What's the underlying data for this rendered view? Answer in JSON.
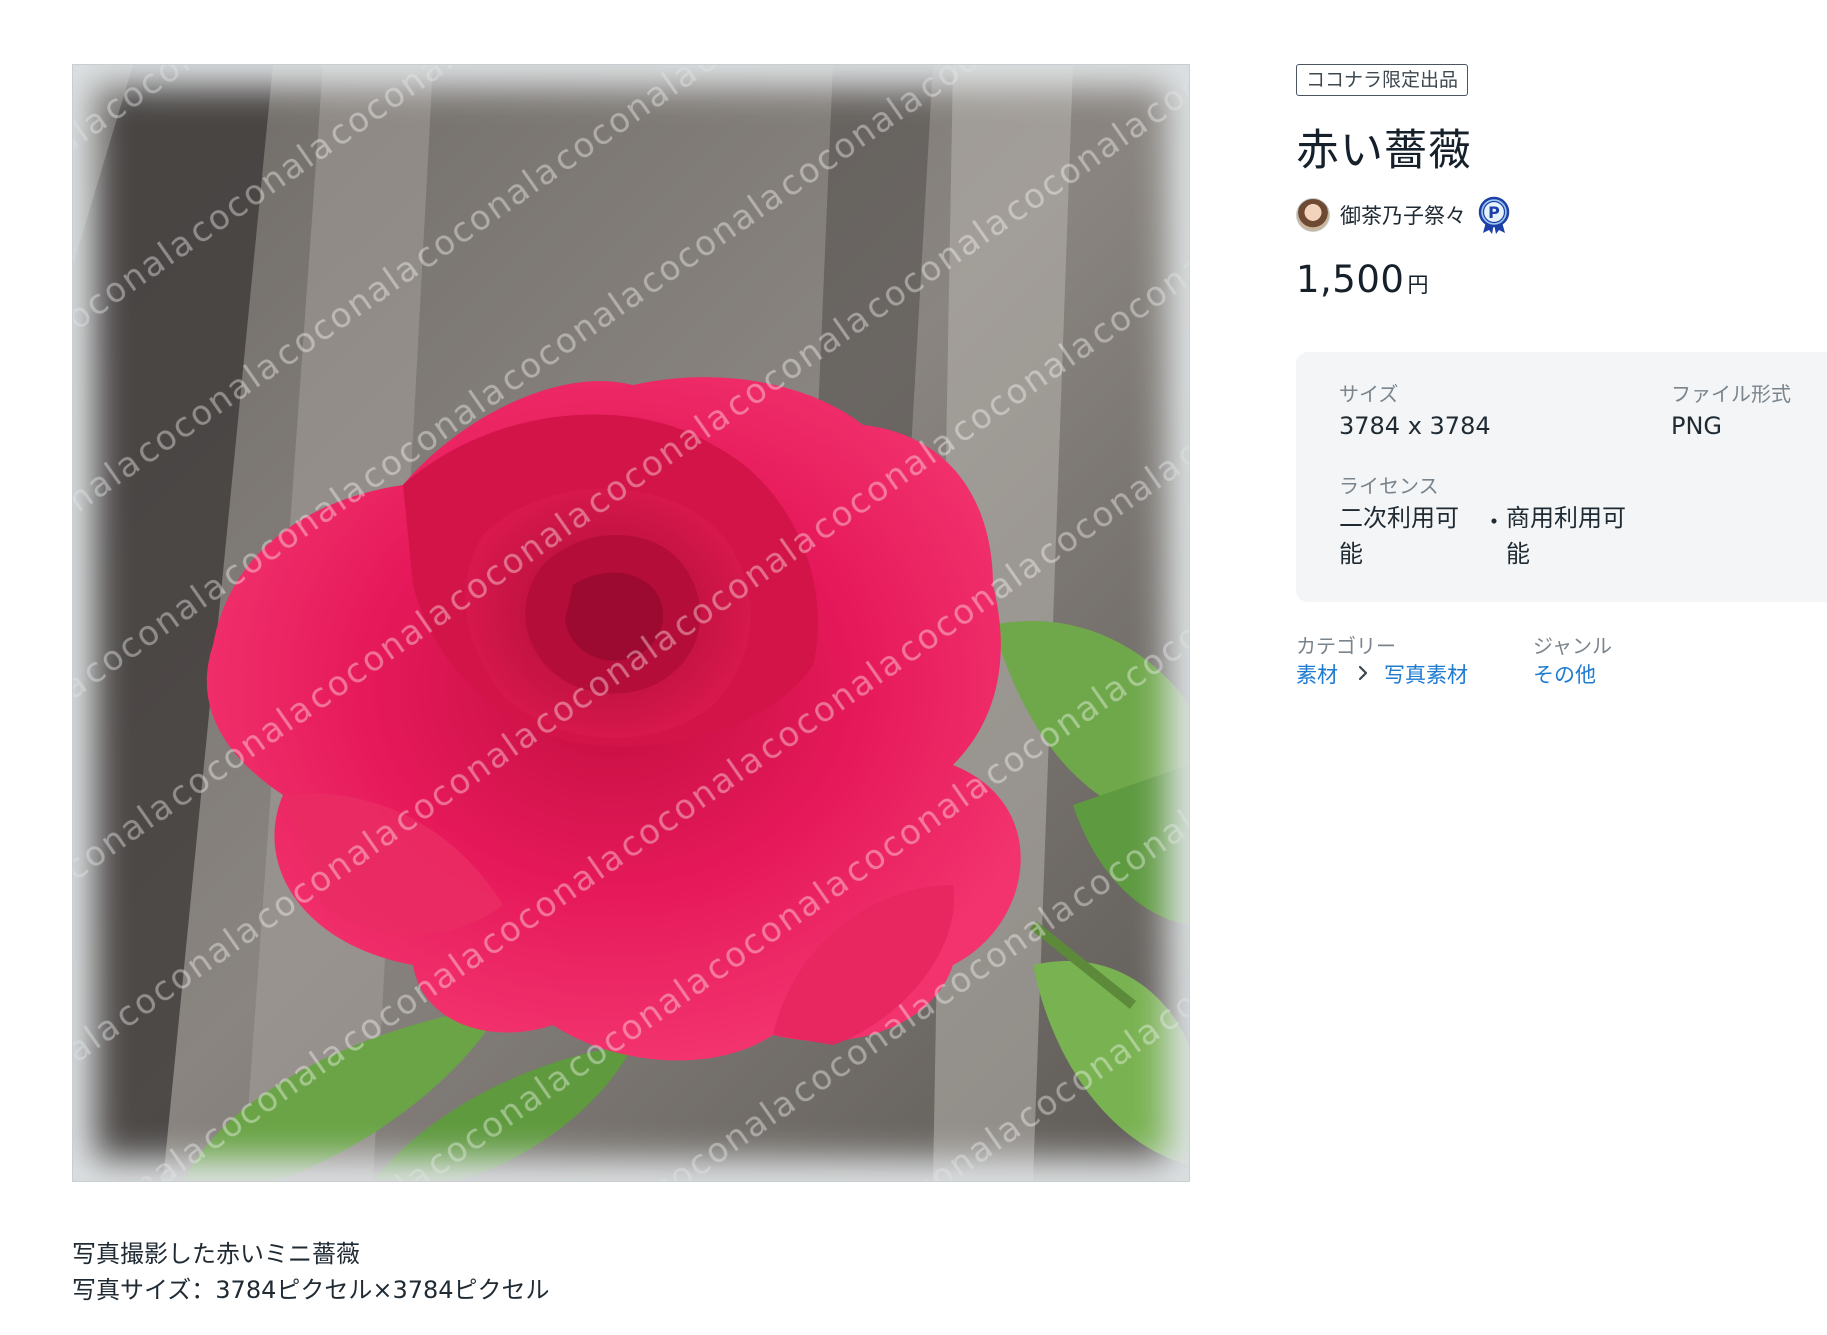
{
  "product": {
    "badge": "ココナラ限定出品",
    "title": "赤い薔薇",
    "seller_name": "御茶乃子祭々",
    "seller_rank_icon": "platinum-rank-icon",
    "price": "1,500",
    "price_unit": "円",
    "image_watermark": "coconala"
  },
  "specs": {
    "size_label": "サイズ",
    "size_value": "3784 x 3784",
    "format_label": "ファイル形式",
    "format_value": "PNG",
    "license_label": "ライセンス",
    "license_items": [
      "二次利用可能",
      "商用利用可能"
    ],
    "license_separator": "・"
  },
  "meta": {
    "category_label": "カテゴリー",
    "category_path": [
      "素材",
      "写真素材"
    ],
    "genre_label": "ジャンル",
    "genre_value": "その他"
  },
  "description": [
    "写真撮影した赤いミニ薔薇",
    "写真サイズ：3784ピクセル×3784ピクセル"
  ],
  "colors": {
    "accent_link": "#1e7bd0",
    "text": "#1f2a33",
    "muted": "#7a848c",
    "rose": "#e0184d",
    "leaf": "#6fa84a"
  }
}
